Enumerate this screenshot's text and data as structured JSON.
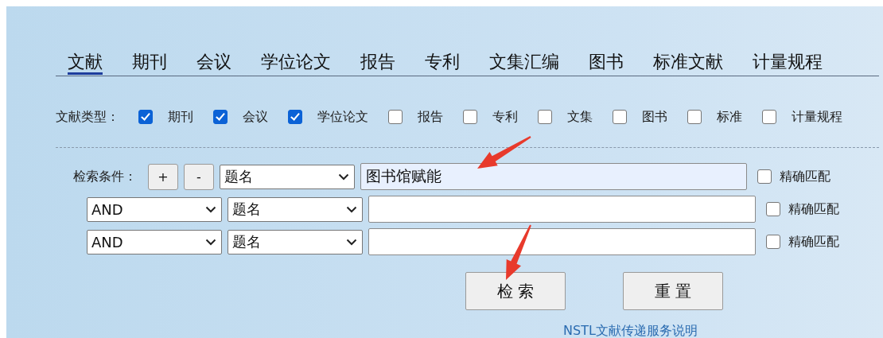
{
  "tabs": [
    {
      "label": "文献",
      "selected": true
    },
    {
      "label": "期刊",
      "selected": false
    },
    {
      "label": "会议",
      "selected": false
    },
    {
      "label": "学位论文",
      "selected": false
    },
    {
      "label": "报告",
      "selected": false
    },
    {
      "label": "专利",
      "selected": false
    },
    {
      "label": "文集汇编",
      "selected": false
    },
    {
      "label": "图书",
      "selected": false
    },
    {
      "label": "标准文献",
      "selected": false
    },
    {
      "label": "计量规程",
      "selected": false
    }
  ],
  "type_filter": {
    "label": "文献类型：",
    "options": [
      {
        "label": "期刊",
        "checked": true
      },
      {
        "label": "会议",
        "checked": true
      },
      {
        "label": "学位论文",
        "checked": true
      },
      {
        "label": "报告",
        "checked": false
      },
      {
        "label": "专利",
        "checked": false
      },
      {
        "label": "文集",
        "checked": false
      },
      {
        "label": "图书",
        "checked": false
      },
      {
        "label": "标准",
        "checked": false
      },
      {
        "label": "计量规程",
        "checked": false
      }
    ]
  },
  "query": {
    "label": "检索条件：",
    "add_button": "+",
    "remove_button": "-",
    "rows": [
      {
        "kind": "first",
        "field": "题名",
        "value": "图书馆赋能",
        "exact_label": "精确匹配",
        "exact": false
      },
      {
        "kind": "combined",
        "operator": "AND",
        "field": "题名",
        "exact_label": "精确匹配",
        "exact": false
      },
      {
        "kind": "combined",
        "operator": "AND",
        "field": "题名",
        "exact_label": "精确匹配",
        "exact": false
      }
    ]
  },
  "buttons": [
    {
      "label": "检 索"
    },
    {
      "label": "重 置"
    }
  ],
  "link": "NSTL文献传递服务说明",
  "annotations": [
    {
      "kind": "arrow"
    },
    {
      "kind": "arrow"
    }
  ]
}
